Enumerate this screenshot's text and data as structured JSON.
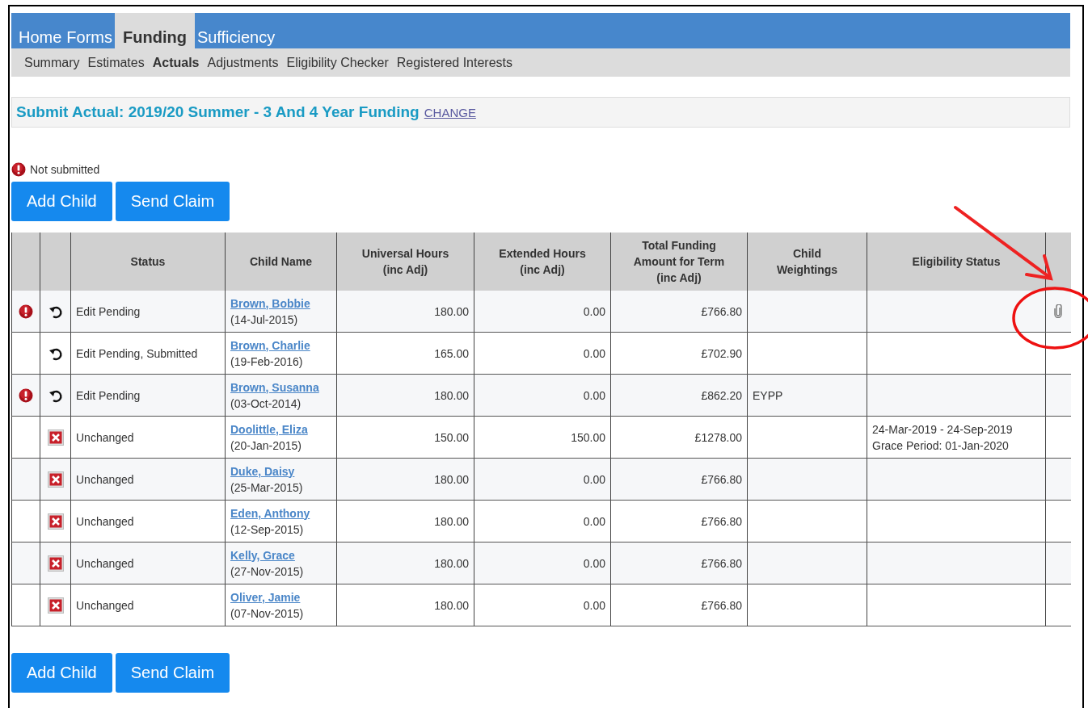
{
  "nav": {
    "tabs": [
      {
        "label": "Home",
        "selected": false
      },
      {
        "label": "Forms",
        "selected": false
      },
      {
        "label": "Funding",
        "selected": true
      },
      {
        "label": "Sufficiency",
        "selected": false
      }
    ]
  },
  "subnav": {
    "items": [
      {
        "label": "Summary",
        "selected": false
      },
      {
        "label": "Estimates",
        "selected": false
      },
      {
        "label": "Actuals",
        "selected": true
      },
      {
        "label": "Adjustments",
        "selected": false
      },
      {
        "label": "Eligibility Checker",
        "selected": false
      },
      {
        "label": "Registered Interests",
        "selected": false
      }
    ]
  },
  "claim": {
    "title": "Submit Actual: 2019/20 Summer - 3 And 4 Year Funding",
    "change_link": "CHANGE"
  },
  "submission_status": {
    "warning": true,
    "text": "Not submitted"
  },
  "buttons_top": [
    "Add Child",
    "Send Claim"
  ],
  "table": {
    "columns": [
      "",
      "",
      "Status",
      "Child Name",
      "Universal Hours (inc Adj)",
      "Extended Hours (inc Adj)",
      "Total Funding Amount for Term (inc Adj)",
      "Child Weightings",
      "Eligibility Status",
      ""
    ],
    "rows": [
      {
        "warning": true,
        "kind": "undo",
        "status": "Edit Pending",
        "name": "Brown, Bobbie",
        "dob": "(14-Jul-2015)",
        "universal": "180.00",
        "extended": "0.00",
        "total": "£766.80",
        "weightings": "",
        "eligibility": [],
        "attachment": true
      },
      {
        "warning": false,
        "kind": "undo",
        "status": "Edit Pending, Submitted",
        "name": "Brown, Charlie",
        "dob": "(19-Feb-2016)",
        "universal": "165.00",
        "extended": "0.00",
        "total": "£702.90",
        "weightings": "",
        "eligibility": [],
        "attachment": false
      },
      {
        "warning": true,
        "kind": "undo",
        "status": "Edit Pending",
        "name": "Brown, Susanna",
        "dob": "(03-Oct-2014)",
        "universal": "180.00",
        "extended": "0.00",
        "total": "£862.20",
        "weightings": "EYPP",
        "eligibility": [],
        "attachment": false
      },
      {
        "warning": false,
        "kind": "remove",
        "status": "Unchanged",
        "name": "Doolittle, Eliza",
        "dob": "(20-Jan-2015)",
        "universal": "150.00",
        "extended": "150.00",
        "total": "£1278.00",
        "weightings": "",
        "eligibility": [
          "24-Mar-2019 - 24-Sep-2019",
          "Grace Period: 01-Jan-2020"
        ],
        "attachment": false
      },
      {
        "warning": false,
        "kind": "remove",
        "status": "Unchanged",
        "name": "Duke, Daisy",
        "dob": "(25-Mar-2015)",
        "universal": "180.00",
        "extended": "0.00",
        "total": "£766.80",
        "weightings": "",
        "eligibility": [],
        "attachment": false
      },
      {
        "warning": false,
        "kind": "remove",
        "status": "Unchanged",
        "name": "Eden, Anthony",
        "dob": "(12-Sep-2015)",
        "universal": "180.00",
        "extended": "0.00",
        "total": "£766.80",
        "weightings": "",
        "eligibility": [],
        "attachment": false
      },
      {
        "warning": false,
        "kind": "remove",
        "status": "Unchanged",
        "name": "Kelly, Grace",
        "dob": "(27-Nov-2015)",
        "universal": "180.00",
        "extended": "0.00",
        "total": "£766.80",
        "weightings": "",
        "eligibility": [],
        "attachment": false
      },
      {
        "warning": false,
        "kind": "remove",
        "status": "Unchanged",
        "name": "Oliver, Jamie",
        "dob": "(07-Nov-2015)",
        "universal": "180.00",
        "extended": "0.00",
        "total": "£766.80",
        "weightings": "",
        "eligibility": [],
        "attachment": false
      }
    ]
  },
  "buttons_bottom": [
    "Add Child",
    "Send Claim"
  ]
}
